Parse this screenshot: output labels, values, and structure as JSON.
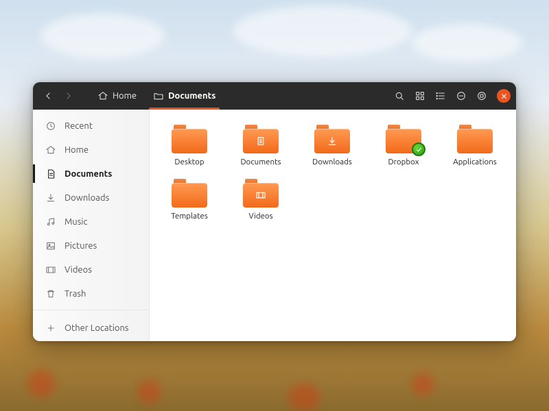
{
  "path": {
    "segments": [
      {
        "label": "Home",
        "icon": "home",
        "active": false
      },
      {
        "label": "Documents",
        "icon": "folder",
        "active": true
      }
    ]
  },
  "window_controls": {
    "close": "×"
  },
  "sidebar": {
    "items": [
      {
        "label": "Recent",
        "icon": "clock",
        "active": false
      },
      {
        "label": "Home",
        "icon": "home",
        "active": false
      },
      {
        "label": "Documents",
        "icon": "doc",
        "active": true
      },
      {
        "label": "Downloads",
        "icon": "download",
        "active": false
      },
      {
        "label": "Music",
        "icon": "music",
        "active": false
      },
      {
        "label": "Pictures",
        "icon": "image",
        "active": false
      },
      {
        "label": "Videos",
        "icon": "video",
        "active": false
      },
      {
        "label": "Trash",
        "icon": "trash",
        "active": false
      }
    ],
    "other": {
      "label": "Other Locations",
      "icon": "plus"
    }
  },
  "folders": [
    {
      "label": "Desktop",
      "glyph": null
    },
    {
      "label": "Documents",
      "glyph": "doc"
    },
    {
      "label": "Downloads",
      "glyph": "download"
    },
    {
      "label": "Dropbox",
      "glyph": null,
      "emblem": "check"
    },
    {
      "label": "Applications",
      "glyph": null
    },
    {
      "label": "Templates",
      "glyph": null
    },
    {
      "label": "Videos",
      "glyph": "video"
    }
  ],
  "accent": "#e95420"
}
